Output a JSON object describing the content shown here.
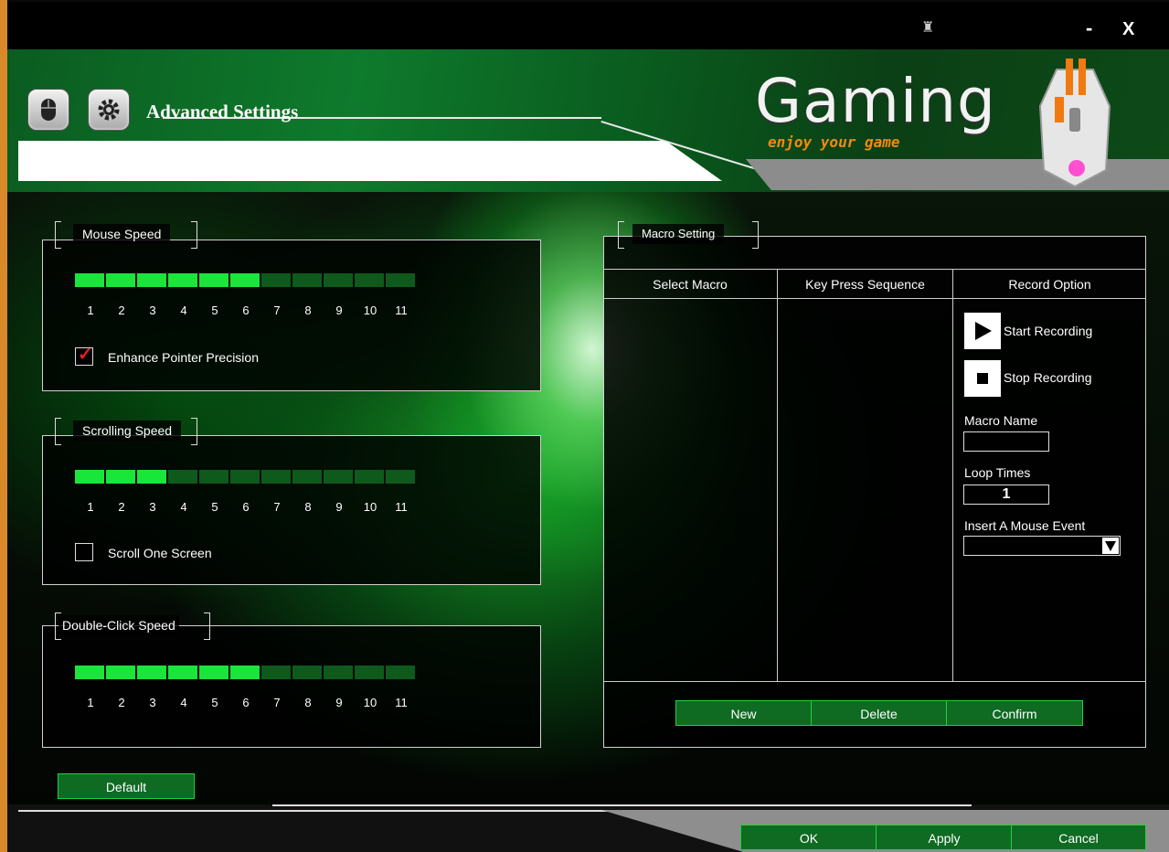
{
  "window": {
    "minimize": "-",
    "close": "X"
  },
  "header": {
    "title": "Advanced Settings",
    "brand": "Gaming",
    "tagline": "enjoy your game"
  },
  "mouse_speed": {
    "caption": "Mouse Speed",
    "level": 6,
    "max": 11,
    "ticks": [
      "1",
      "2",
      "3",
      "4",
      "5",
      "6",
      "7",
      "8",
      "9",
      "10",
      "11"
    ],
    "option_label": "Enhance Pointer Precision",
    "option_checked": true
  },
  "scrolling_speed": {
    "caption": "Scrolling Speed",
    "level": 3,
    "max": 11,
    "ticks": [
      "1",
      "2",
      "3",
      "4",
      "5",
      "6",
      "7",
      "8",
      "9",
      "10",
      "11"
    ],
    "option_label": "Scroll One Screen",
    "option_checked": false
  },
  "double_click_speed": {
    "caption": "Double-Click Speed",
    "level": 6,
    "max": 11,
    "ticks": [
      "1",
      "2",
      "3",
      "4",
      "5",
      "6",
      "7",
      "8",
      "9",
      "10",
      "11"
    ]
  },
  "default_button": "Default",
  "macro": {
    "caption": "Macro Setting",
    "col_select": "Select Macro",
    "col_sequence": "Key Press Sequence",
    "col_record": "Record Option",
    "start_recording": "Start Recording",
    "stop_recording": "Stop Recording",
    "macro_name_label": "Macro Name",
    "macro_name_value": "",
    "loop_times_label": "Loop Times",
    "loop_times_value": "1",
    "mouse_event_label": "Insert A Mouse Event",
    "mouse_event_value": "",
    "btn_new": "New",
    "btn_delete": "Delete",
    "btn_confirm": "Confirm"
  },
  "footer": {
    "ok": "OK",
    "apply": "Apply",
    "cancel": "Cancel"
  },
  "colors": {
    "accent": "#19e63a",
    "frame": "#d9892a",
    "header_green": "#0e7a2c"
  }
}
